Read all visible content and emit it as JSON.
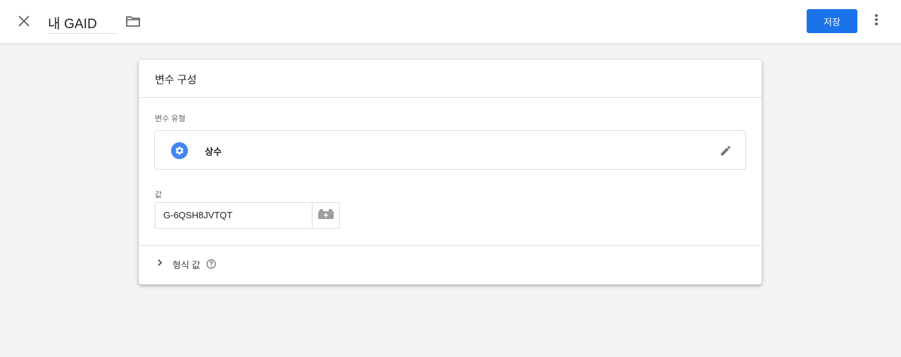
{
  "topbar": {
    "title": "내 GAID",
    "save_label": "저장",
    "icons": {
      "close": "close-icon",
      "folder": "folder-icon",
      "more": "more-vert-icon"
    }
  },
  "card": {
    "title": "변수 구성",
    "variable_type": {
      "label": "변수 유형",
      "name": "상수",
      "icon": "gear-icon"
    },
    "value": {
      "label": "값",
      "input_value": "G-6QSH8JVTQT"
    },
    "format_value": {
      "label": "형식 값"
    }
  },
  "colors": {
    "accent": "#1a73e8",
    "type_icon_bg": "#4285f4",
    "background": "#f1f3f4"
  }
}
